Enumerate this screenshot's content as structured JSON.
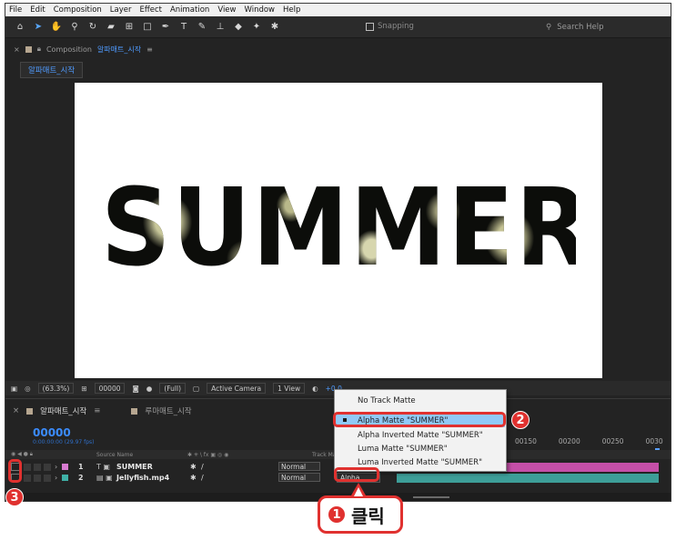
{
  "menu": [
    "File",
    "Edit",
    "Composition",
    "Layer",
    "Effect",
    "Animation",
    "View",
    "Window",
    "Help"
  ],
  "toolbar": {
    "snapping_label": "Snapping",
    "search_placeholder": "Search Help"
  },
  "composition_panel": {
    "panel_prefix": "Composition",
    "comp_name": "알파매트_시작",
    "viewer_tab": "알파매트_시작",
    "preview_text": "SUMMER"
  },
  "viewer_bar": {
    "zoom": "(63.3%)",
    "timecode": "00000",
    "resolution": "(Full)",
    "camera": "Active Camera",
    "view": "1 View",
    "exposure": "+0.0"
  },
  "timeline": {
    "tabs": [
      "알파매트_시작",
      "루마매트_시작"
    ],
    "timecode": "00000",
    "timecode_sub": "0:00:00:00 (29.97 fps)",
    "col_source_name": "Source Name",
    "col_track_matte": "Track Matte",
    "ruler": [
      "00150",
      "00200",
      "00250",
      "0030"
    ],
    "layers": [
      {
        "num": "1",
        "name": "SUMMER",
        "mode": "Normal",
        "label_color": "#d77ad0"
      },
      {
        "num": "2",
        "name": "Jellyfish.mp4",
        "mode": "Normal",
        "label_color": "#3fb0a6",
        "track_matte": "Alpha"
      }
    ]
  },
  "track_matte_menu": {
    "items": [
      "No Track Matte",
      "Alpha Matte \"SUMMER\"",
      "Alpha Inverted Matte \"SUMMER\"",
      "Luma Matte \"SUMMER\"",
      "Luma Inverted Matte \"SUMMER\""
    ],
    "selected_index": 1
  },
  "annotations": {
    "step1_num": "1",
    "step1_text": "클릭",
    "step2_num": "2",
    "step3_num": "3",
    "highlight_color": "#e0312f"
  }
}
